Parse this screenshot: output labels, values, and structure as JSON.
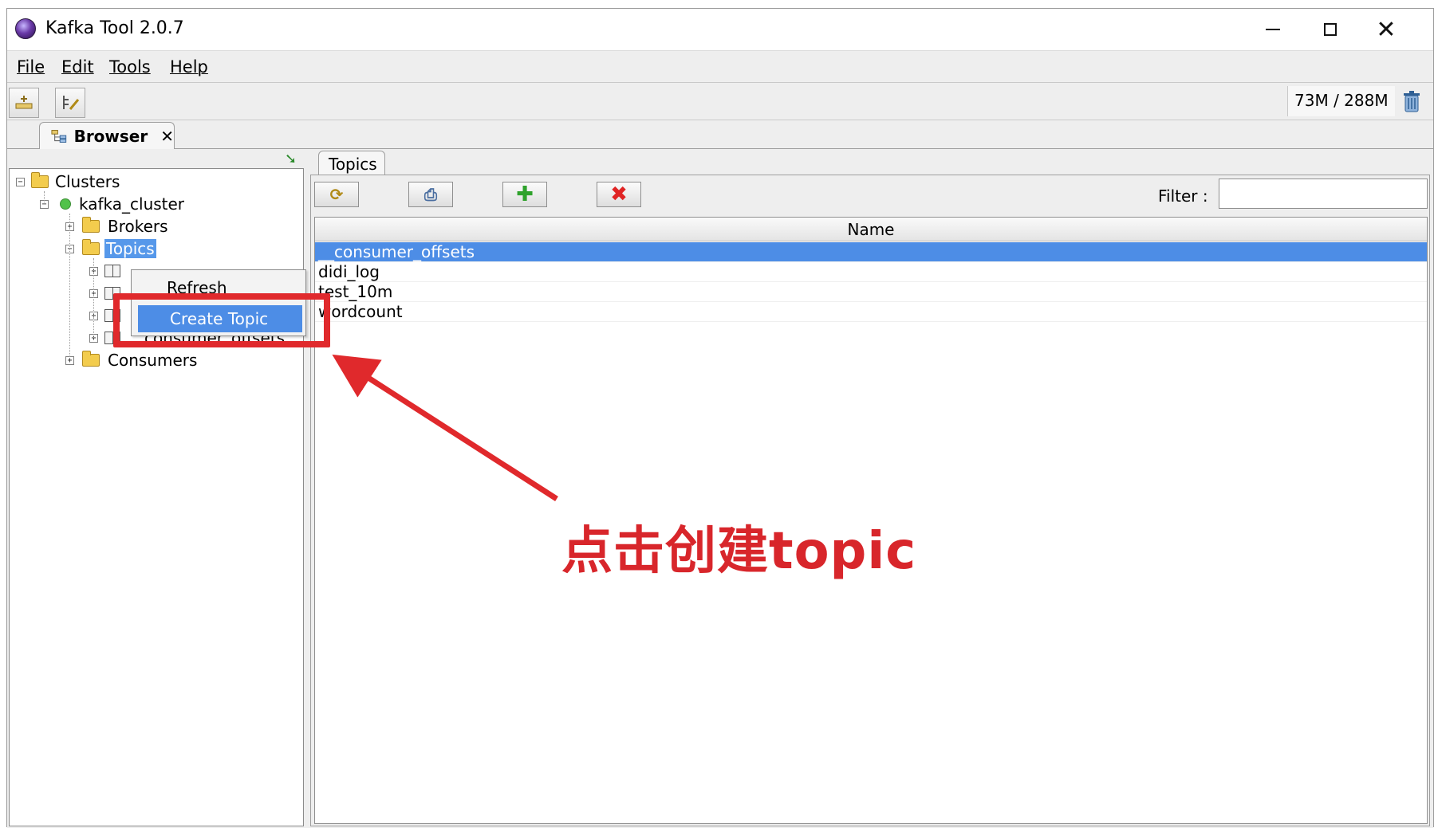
{
  "window": {
    "title": "Kafka Tool  2.0.7",
    "controls": {
      "minimize": "minimize",
      "maximize": "maximize",
      "close": "✕"
    }
  },
  "menubar": {
    "items": [
      "File",
      "Edit",
      "Tools",
      "Help"
    ]
  },
  "toolbar": {
    "memory": "73M / 288M"
  },
  "tabs": {
    "browser_label": "Browser",
    "close_glyph": "✕"
  },
  "tree": {
    "clusters": "Clusters",
    "cluster_name": "kafka_cluster",
    "brokers": "Brokers",
    "topics": "Topics",
    "topic_children": [
      "",
      "",
      "",
      "__consumer_offsets"
    ],
    "consumers": "Consumers"
  },
  "context_menu": {
    "refresh": "Refresh",
    "create_topic": "Create Topic"
  },
  "topics_panel": {
    "tab_label": "Topics",
    "filter_label": "Filter :",
    "filter_value": "",
    "column_header": "Name",
    "rows": [
      "__consumer_offsets",
      "didi_log",
      "test_10m",
      "wordcount"
    ],
    "selected_row_index": 0,
    "buttons": {
      "refresh": "⟳",
      "print": "⎙",
      "add": "✚",
      "delete": "✖"
    }
  },
  "annotation": {
    "text": "点击创建topic",
    "color": "#d8262b"
  },
  "colors": {
    "selection": "#4d8de6",
    "tree_selection": "#5698ea",
    "status_ok": "#52c24a"
  }
}
